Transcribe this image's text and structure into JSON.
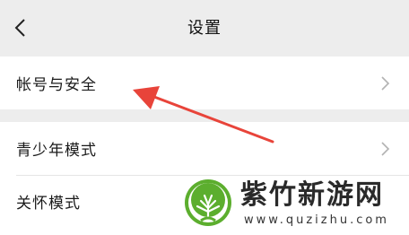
{
  "nav": {
    "title": "设置",
    "back_icon": "chevron-left-icon"
  },
  "settings": {
    "group1": [
      {
        "label": "帐号与安全",
        "icon": "chevron-right-icon"
      }
    ],
    "group2": [
      {
        "label": "青少年模式",
        "icon": "chevron-right-icon"
      },
      {
        "label": "关怀模式",
        "icon": "chevron-right-icon"
      }
    ]
  },
  "annotation": {
    "arrow_color": "#e8443a"
  },
  "watermark": {
    "title": "紫竹新游网",
    "url": "www.quzizhu.com",
    "logo_color": "#5cae2e"
  }
}
